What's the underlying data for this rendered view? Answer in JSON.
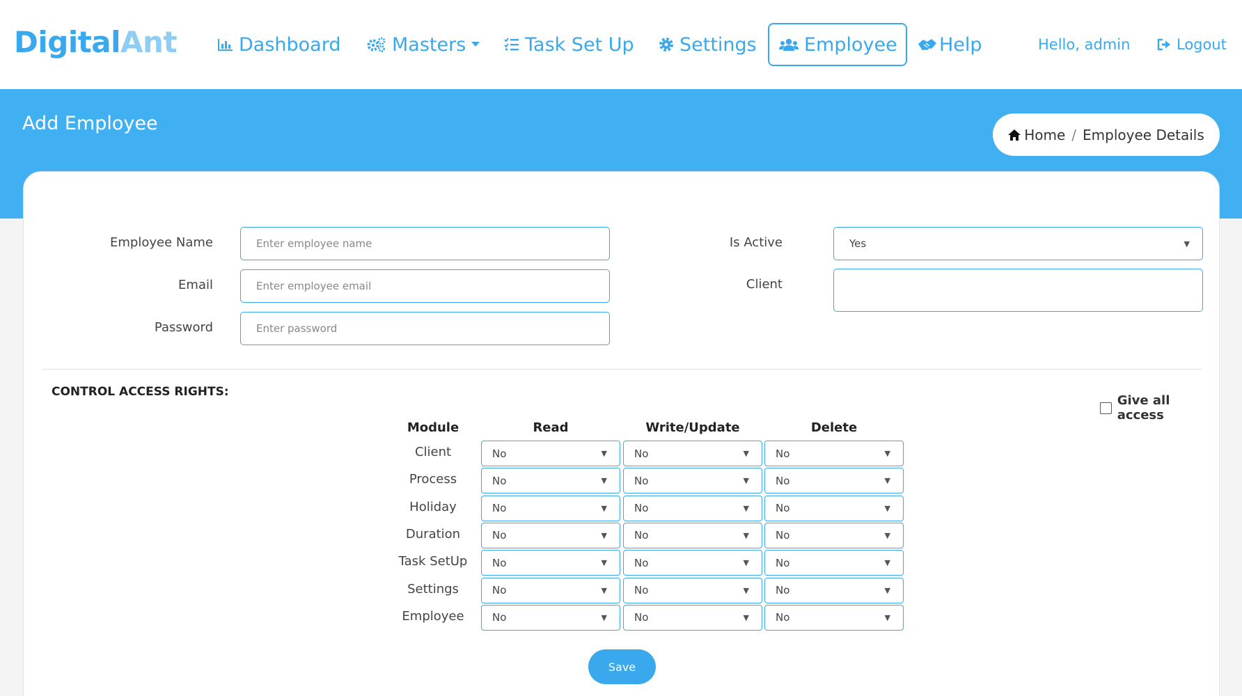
{
  "brand": {
    "part1": "Digital",
    "part2": "Ant"
  },
  "nav": {
    "dashboard": "Dashboard",
    "masters": "Masters",
    "task_setup": "Task Set Up",
    "settings": "Settings",
    "employee": "Employee",
    "help": "Help",
    "greeting": "Hello, admin",
    "logout": "Logout"
  },
  "page": {
    "title": "Add Employee"
  },
  "breadcrumb": {
    "home": "Home",
    "separator": "/",
    "current": "Employee Details"
  },
  "form": {
    "name_label": "Employee Name",
    "name_placeholder": "Enter employee name",
    "email_label": "Email",
    "email_placeholder": "Enter employee email",
    "password_label": "Password",
    "password_placeholder": "Enter password",
    "active_label": "Is Active",
    "active_value": "Yes",
    "client_label": "Client",
    "client_value": ""
  },
  "access": {
    "title": "CONTROL ACCESS RIGHTS:",
    "give_all_label": "Give all access",
    "give_all_checked": false,
    "headers": {
      "module": "Module",
      "read": "Read",
      "write": "Write/Update",
      "delete": "Delete"
    },
    "rows": [
      {
        "module": "Client",
        "read": "No",
        "write": "No",
        "delete": "No"
      },
      {
        "module": "Process",
        "read": "No",
        "write": "No",
        "delete": "No"
      },
      {
        "module": "Holiday",
        "read": "No",
        "write": "No",
        "delete": "No"
      },
      {
        "module": "Duration",
        "read": "No",
        "write": "No",
        "delete": "No"
      },
      {
        "module": "Task SetUp",
        "read": "No",
        "write": "No",
        "delete": "No"
      },
      {
        "module": "Settings",
        "read": "No",
        "write": "No",
        "delete": "No"
      },
      {
        "module": "Employee",
        "read": "No",
        "write": "No",
        "delete": "No"
      }
    ]
  },
  "actions": {
    "save": "Save"
  },
  "colors": {
    "accent": "#3aa8ec",
    "hero": "#41b0f2",
    "logo_light": "#8fcdf3"
  }
}
